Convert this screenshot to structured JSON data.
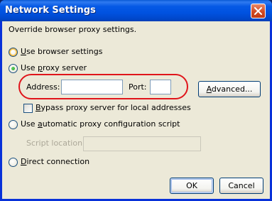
{
  "window": {
    "title": "Network Settings"
  },
  "intro_text": "Override browser proxy settings.",
  "options": {
    "use_browser": {
      "label_prefix": "U",
      "label_rest": "se browser settings",
      "selected": false
    },
    "use_proxy": {
      "label_prefix": "Use ",
      "label_mnemonic": "p",
      "label_rest": "roxy server",
      "selected": true
    },
    "auto_config": {
      "label_prefix": "Use ",
      "label_mnemonic": "a",
      "label_rest": "utomatic proxy configuration script",
      "selected": false
    },
    "direct": {
      "label_prefix": "D",
      "label_rest": "irect connection",
      "selected": false
    }
  },
  "proxy": {
    "address_label": "Address:",
    "address_value": "",
    "port_label": "Port:",
    "port_value": "",
    "advanced_label_mnemonic": "A",
    "advanced_label_rest": "dvanced...",
    "bypass_mnemonic": "B",
    "bypass_rest": "ypass proxy server for local addresses",
    "bypass_checked": false
  },
  "script": {
    "location_label": "Script location:",
    "location_value": ""
  },
  "buttons": {
    "ok": "OK",
    "cancel": "Cancel"
  },
  "colors": {
    "title_bar": "#0054e3",
    "dialog_bg": "#ece9d8",
    "highlight": "#e0151b",
    "radio_selected": "#21a121"
  },
  "icons": {
    "close": "close-icon"
  }
}
